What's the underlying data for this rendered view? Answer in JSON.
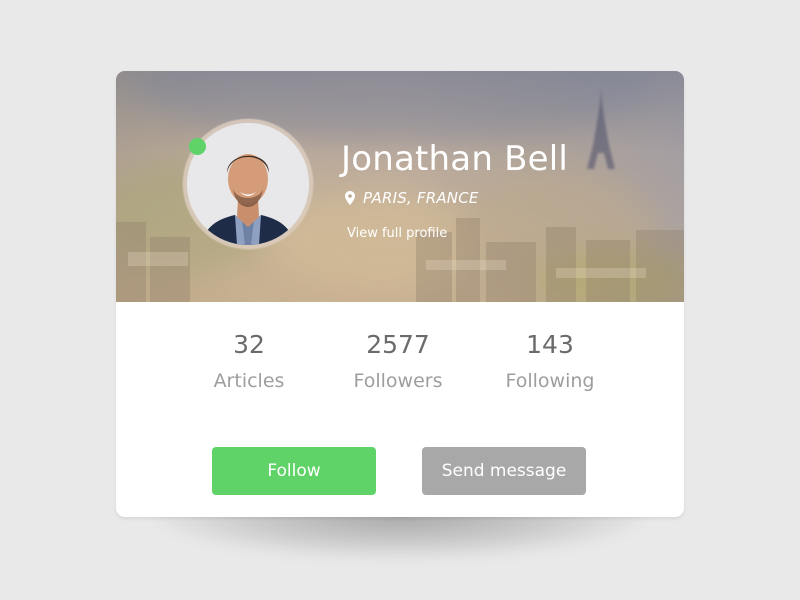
{
  "profile": {
    "name": "Jonathan Bell",
    "location": "PARIS, FRANCE",
    "view_profile_label": "View full profile",
    "online": true
  },
  "stats": [
    {
      "value": "32",
      "label": "Articles"
    },
    {
      "value": "2577",
      "label": "Followers"
    },
    {
      "value": "143",
      "label": "Following"
    }
  ],
  "actions": {
    "follow_label": "Follow",
    "message_label": "Send message"
  },
  "icons": {
    "location": "map-pin-icon"
  },
  "colors": {
    "accent_green": "#5fd367",
    "secondary_gray": "#a8a8a8",
    "stat_value": "#6b6b6b",
    "stat_label": "#9e9e9e"
  }
}
